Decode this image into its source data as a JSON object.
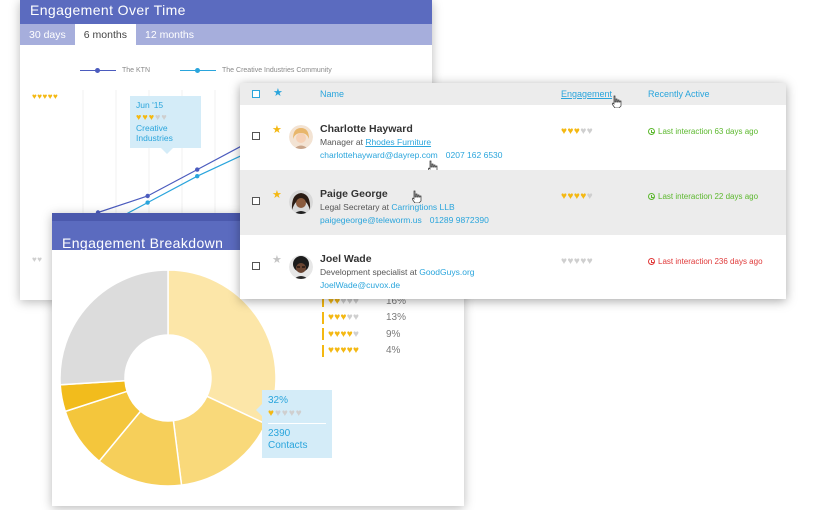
{
  "colors": {
    "accent": "#5b6bbf",
    "link": "#2aa5dc",
    "heart_on": "#f4b812",
    "heart_off": "#cfcfcf",
    "active_green": "#5cb82e",
    "inactive_red": "#e03a3a",
    "series_ktn": "#4b5bbe",
    "series_creative": "#2aa5dc"
  },
  "time_card": {
    "title": "Engagement Over Time",
    "tabs": [
      {
        "label": "30 days",
        "active": false
      },
      {
        "label": "6 months",
        "active": true
      },
      {
        "label": "12 months",
        "active": false
      }
    ],
    "legend": [
      "The KTN",
      "The Creative Industries Community"
    ],
    "tooltip": {
      "date": "Jun '15",
      "hearts": 3,
      "line1": "Creative",
      "line2": "Industries"
    }
  },
  "chart_data": {
    "type": "line",
    "series": [
      {
        "name": "The KTN",
        "values": [
          1.5,
          2.0,
          2.8,
          3.6,
          4.4
        ]
      },
      {
        "name": "The Creative Industries Community",
        "values": [
          1.0,
          1.8,
          2.6,
          3.3,
          3.7
        ]
      }
    ],
    "ylim": [
      0,
      5
    ],
    "y_axis_hearts": {
      "top": 5,
      "bottom": 5
    }
  },
  "breakdown_card": {
    "title": "Engagement Breakdown",
    "slices": [
      {
        "label": "Contacts",
        "hearts": 1,
        "percent": "32%",
        "value": 32
      },
      {
        "label": "2 hearts",
        "hearts": 2,
        "percent": "16%",
        "value": 16
      },
      {
        "label": "3 hearts",
        "hearts": 3,
        "percent": "13%",
        "value": 13
      },
      {
        "label": "4 hearts",
        "hearts": 4,
        "percent": "9%",
        "value": 9
      },
      {
        "label": "5 hearts",
        "hearts": 5,
        "percent": "4%",
        "value": 4
      },
      {
        "label": "none",
        "hearts": 0,
        "percent": "26%",
        "value": 26
      }
    ],
    "rows": [
      {
        "hearts": 2,
        "percent": "16%",
        "bar": "#f4b812"
      },
      {
        "hearts": 3,
        "percent": "13%",
        "bar": "#f4b812"
      },
      {
        "hearts": 4,
        "percent": "9%",
        "bar": "#f4b812"
      },
      {
        "hearts": 5,
        "percent": "4%",
        "bar": "#f4b812"
      }
    ],
    "tooltip": {
      "percent": "32%",
      "hearts": 1,
      "count": "2390",
      "label": "Contacts"
    }
  },
  "table": {
    "headers": {
      "name": "Name",
      "engagement": "Engagement",
      "recently_active": "Recently Active"
    },
    "rows": [
      {
        "starred": true,
        "name": "Charlotte Hayward",
        "role_prefix": "Manager at ",
        "company": "Rhodes Furniture",
        "email": "charlottehayward@dayrep.com",
        "phone": "0207 162 6530",
        "hearts": 3,
        "last": "Last interaction 63 days ago",
        "recent": true
      },
      {
        "starred": true,
        "name": "Paige George",
        "role_prefix": "Legal Secretary at ",
        "company": "Carringtions LLB",
        "email": "paigegeorge@teleworm.us",
        "phone": "01289 9872390",
        "hearts": 4,
        "last": "Last interaction 22 days ago",
        "recent": true
      },
      {
        "starred": false,
        "name": "Joel Wade",
        "role_prefix": "Development specialist at ",
        "company": "GoodGuys.org",
        "email": "JoelWade@cuvox.de",
        "phone": "",
        "hearts": 0,
        "last": "Last interaction 236 days ago",
        "recent": false
      }
    ]
  }
}
